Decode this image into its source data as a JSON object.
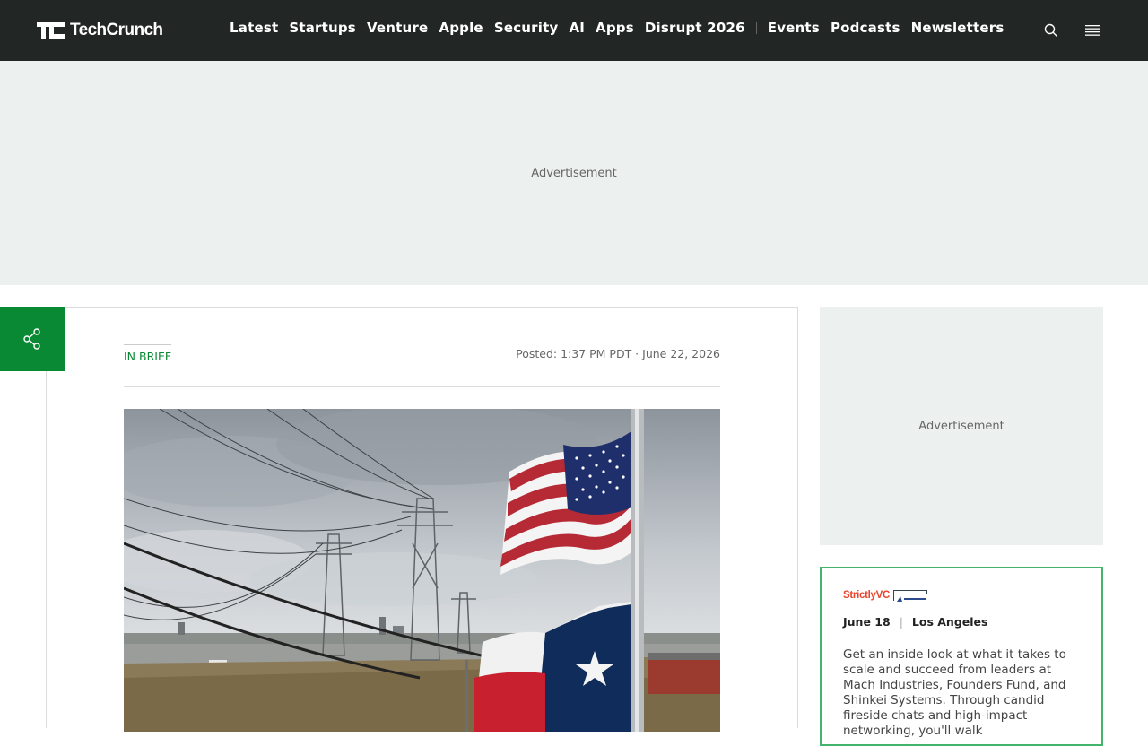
{
  "header": {
    "logo_text": "TechCrunch",
    "nav": [
      "Latest",
      "Startups",
      "Venture",
      "Apple",
      "Security",
      "AI",
      "Apps",
      "Disrupt 2026"
    ],
    "nav_secondary": [
      "Events",
      "Podcasts",
      "Newsletters"
    ],
    "search_icon": "search-icon",
    "menu_icon": "hamburger-menu-icon"
  },
  "ads": {
    "top_label": "Advertisement",
    "side_label": "Advertisement"
  },
  "article": {
    "kicker": "IN BRIEF",
    "posted": "Posted: 1:37 PM PDT · June 22, 2026"
  },
  "event": {
    "brand": "StrictlyVC",
    "partner_logo": "AEROSPACE",
    "date": "June 18",
    "location": "Los Angeles",
    "description": "Get an inside look at what it takes to scale and succeed from leaders at Mach Industries, Founders Fund, and Shinkei Systems. Through candid fireside chats and high-impact networking, you'll walk"
  },
  "colors": {
    "header_bg": "#222624",
    "accent_green": "#0a8935",
    "ad_bg": "#ecf0ef",
    "event_border": "#44b36b"
  }
}
